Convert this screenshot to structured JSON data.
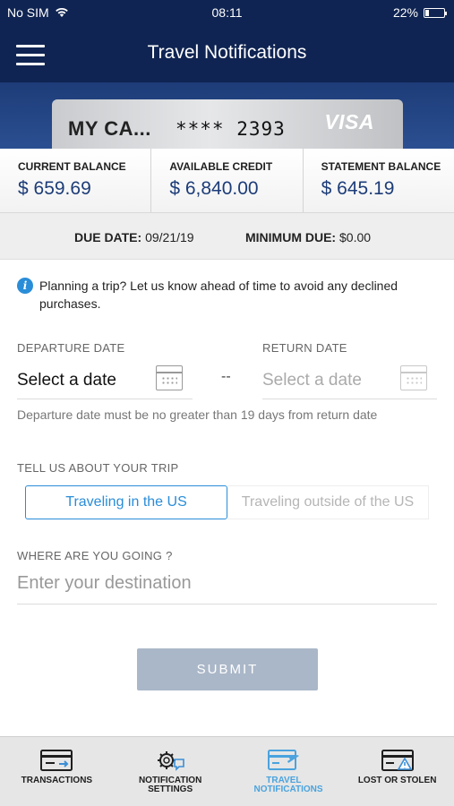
{
  "status_bar": {
    "carrier": "No SIM",
    "time": "08:11",
    "battery": "22%",
    "battery_level": 0.22
  },
  "header": {
    "title": "Travel Notifications",
    "menu_icon": "hamburger-menu-icon"
  },
  "card": {
    "name": "MY CA...",
    "number": "**** 2393",
    "brand": "VISA"
  },
  "balances": [
    {
      "label": "CURRENT BALANCE",
      "value": "$ 659.69"
    },
    {
      "label": "AVAILABLE CREDIT",
      "value": "$ 6,840.00"
    },
    {
      "label": "STATEMENT BALANCE",
      "value": "$ 645.19"
    }
  ],
  "due": {
    "due_label": "DUE DATE:",
    "due_value": "09/21/19",
    "min_label": "MINIMUM DUE:",
    "min_value": "$0.00"
  },
  "form": {
    "info_icon": "info-icon",
    "info_text": "Planning a trip? Let us know ahead of time to avoid any declined purchases.",
    "departure_label": "DEPARTURE DATE",
    "departure_value": "Select a date",
    "separator": "--",
    "return_label": "RETURN DATE",
    "return_placeholder": "Select a date",
    "hint": "Departure date must be no greater than 19 days from return date",
    "trip_label": "TELL US ABOUT YOUR TRIP",
    "trip_options": [
      "Traveling in the US",
      "Traveling outside of the US"
    ],
    "trip_selected": "Traveling in the US",
    "destination_label": "WHERE ARE YOU GOING ?",
    "destination_placeholder": "Enter your destination",
    "submit_label": "SUBMIT"
  },
  "tabbar": [
    {
      "label": "TRANSACTIONS",
      "icon": "card-transactions-icon"
    },
    {
      "label": "NOTIFICATION SETTINGS",
      "icon": "gear-notification-icon"
    },
    {
      "label": "TRAVEL NOTIFICATIONS",
      "icon": "card-plane-icon",
      "active": true
    },
    {
      "label": "LOST OR STOLEN",
      "icon": "card-warning-icon"
    }
  ],
  "colors": {
    "navy": "#0f2452",
    "accent_blue": "#2a8dd8",
    "balance_blue": "#1d3c78",
    "submit_disabled": "#aab7c8"
  }
}
